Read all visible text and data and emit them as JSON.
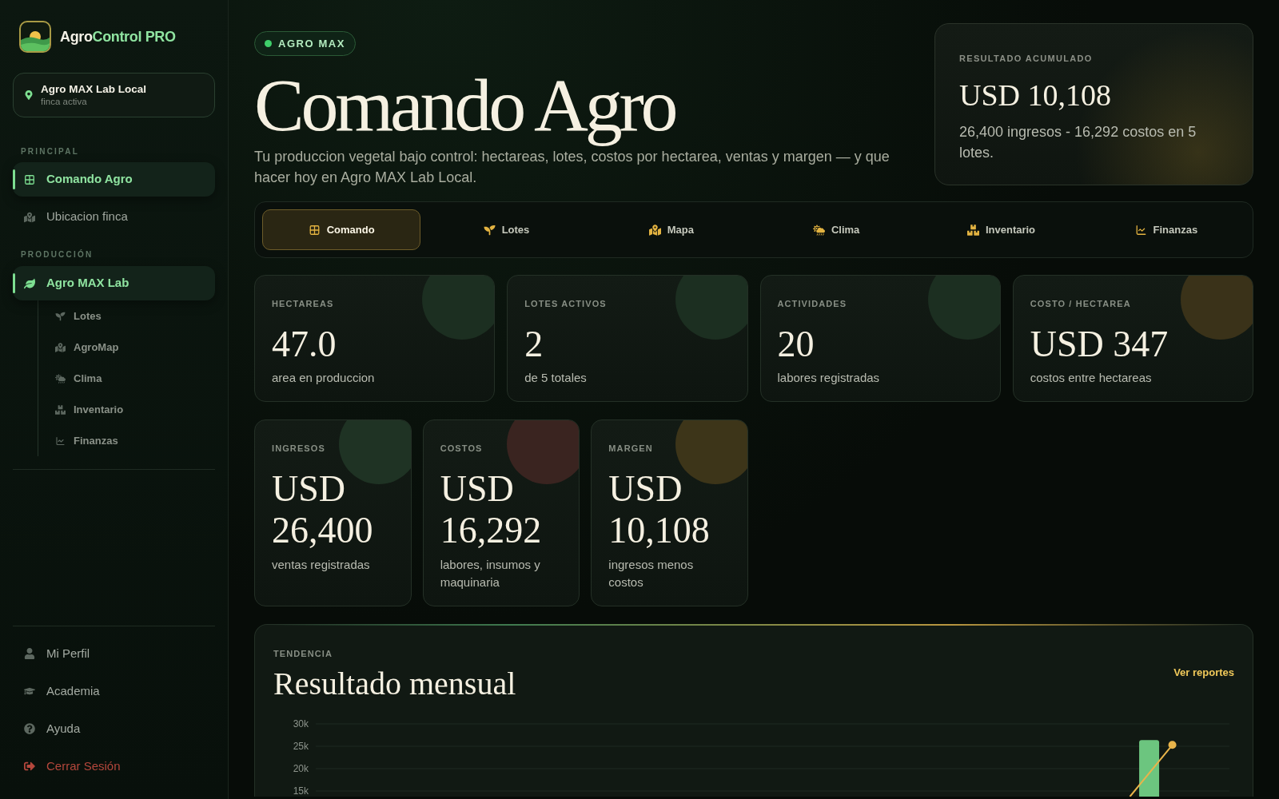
{
  "sidebar": {
    "brand": {
      "lead": "Agro",
      "accent": "Control PRO"
    },
    "farm": {
      "name": "Agro MAX Lab Local",
      "caption": "finca activa"
    },
    "sections": [
      {
        "title": "PRINCIPAL",
        "items": [
          {
            "label": "Comando Agro",
            "selected": true
          },
          {
            "label": "Ubicacion finca",
            "selected": false
          }
        ]
      },
      {
        "title": "PRODUCCIÓN",
        "items": [
          {
            "label": "Agro MAX Lab",
            "selected": true,
            "children": [
              {
                "label": "Lotes",
                "selected": false
              },
              {
                "label": "AgroMap",
                "selected": false
              },
              {
                "label": "Clima",
                "selected": false
              },
              {
                "label": "Inventario",
                "selected": false
              },
              {
                "label": "Finanzas",
                "selected": false
              }
            ]
          }
        ]
      }
    ],
    "footer_items": [
      {
        "label": "Mi Perfil",
        "kind": "normal"
      },
      {
        "label": "Academia",
        "kind": "normal"
      },
      {
        "label": "Ayuda",
        "kind": "normal"
      },
      {
        "label": "Cerrar Sesión",
        "kind": "danger"
      }
    ]
  },
  "header": {
    "badge": "AGRO MAX",
    "title": "Comando Agro",
    "subtitle": "Tu produccion vegetal bajo control: hectareas, lotes, costos por hectarea, ventas y margen — y que hacer hoy en Agro MAX Lab Local."
  },
  "result_card": {
    "label": "RESULTADO ACUMULADO",
    "value": "USD 10,108",
    "detail": "26,400 ingresos - 16,292 costos en 5 lotes."
  },
  "tabs": [
    {
      "label": "Comando",
      "selected": true
    },
    {
      "label": "Lotes",
      "selected": false
    },
    {
      "label": "Mapa",
      "selected": false
    },
    {
      "label": "Clima",
      "selected": false
    },
    {
      "label": "Inventario",
      "selected": false
    },
    {
      "label": "Finanzas",
      "selected": false
    }
  ],
  "stats": [
    {
      "label": "HECTAREAS",
      "value": "47.0",
      "caption": "area en produccion",
      "color": "#1c2f21"
    },
    {
      "label": "LOTES ACTIVOS",
      "value": "2",
      "caption": "de 5 totales",
      "color": "#1c2f21"
    },
    {
      "label": "ACTIVIDADES",
      "value": "20",
      "caption": "labores registradas",
      "color": "#1c2f21"
    },
    {
      "label": "COSTO / HECTAREA",
      "value": "USD 347",
      "caption": "costos entre hectareas",
      "color": "#3a3219"
    }
  ],
  "money_stats": [
    {
      "label": "INGRESOS",
      "value": "USD 26,400",
      "caption": "ventas registradas",
      "color": "#1f3324"
    },
    {
      "label": "COSTOS",
      "value": "USD 16,292",
      "caption": "labores, insumos y maquinaria",
      "color": "#3a2420"
    },
    {
      "label": "MARGEN",
      "value": "USD 10,108",
      "caption": "ingresos menos costos",
      "color": "#3d3519"
    }
  ],
  "chart_card": {
    "eyebrow": "TENDENCIA",
    "title": "Resultado mensual",
    "link": "Ver reportes",
    "chart_data": {
      "type": "bar",
      "grid": true,
      "categories": [
        null,
        null,
        null,
        null,
        null,
        null,
        null,
        null
      ],
      "ylim": [
        13750,
        30000
      ],
      "yticks": [
        {
          "value": 30000,
          "label": "30k"
        },
        {
          "value": 25000,
          "label": "25k"
        },
        {
          "value": 20000,
          "label": "20k"
        },
        {
          "value": 15000,
          "label": "15k"
        }
      ],
      "series": [
        {
          "type": "bar",
          "color": "#6cc57f",
          "values": [
            null,
            null,
            null,
            null,
            null,
            null,
            null,
            26400
          ]
        },
        {
          "type": "line",
          "color": "#e8b44a",
          "marker": "circle",
          "values": [
            null,
            null,
            null,
            null,
            null,
            null,
            null,
            25300
          ]
        }
      ]
    }
  }
}
